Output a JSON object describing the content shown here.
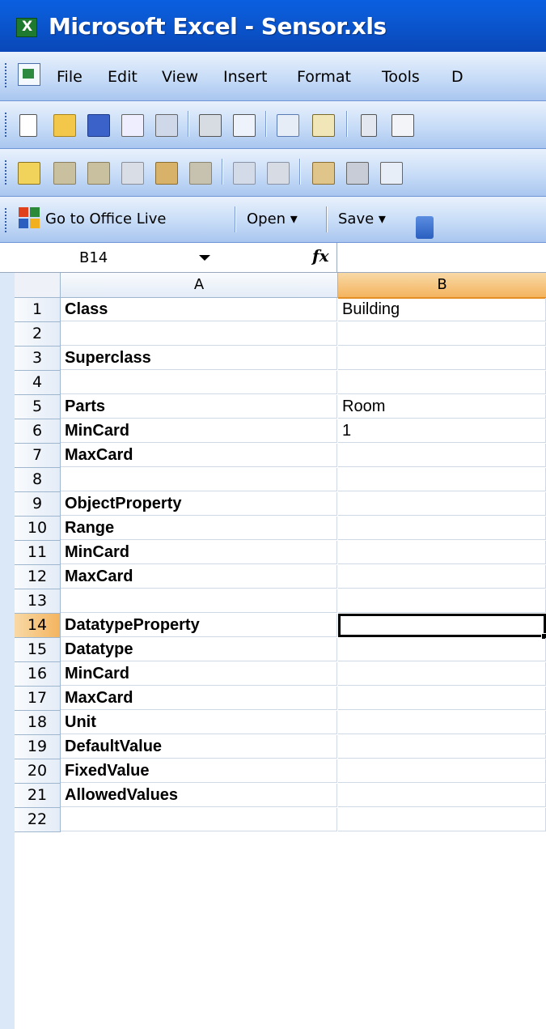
{
  "window": {
    "title": "Microsoft Excel - Sensor.xls"
  },
  "menu": {
    "items": [
      "File",
      "Edit",
      "View",
      "Insert",
      "Format",
      "Tools",
      "D"
    ]
  },
  "office_live_bar": {
    "go_to_label": "Go to Office Live",
    "open_label": "Open ▾",
    "save_label": "Save ▾"
  },
  "formula_bar": {
    "name_box": "B14",
    "fx_label": "fx",
    "value": ""
  },
  "sheet": {
    "columns": [
      "A",
      "B"
    ],
    "active_column": "B",
    "active_row": 14,
    "rows": [
      {
        "n": "1",
        "a": "Class",
        "b": "Building"
      },
      {
        "n": "2",
        "a": "",
        "b": ""
      },
      {
        "n": "3",
        "a": "Superclass",
        "b": ""
      },
      {
        "n": "4",
        "a": "",
        "b": ""
      },
      {
        "n": "5",
        "a": "Parts",
        "b": "Room"
      },
      {
        "n": "6",
        "a": "MinCard",
        "b": "1"
      },
      {
        "n": "7",
        "a": "MaxCard",
        "b": ""
      },
      {
        "n": "8",
        "a": "",
        "b": ""
      },
      {
        "n": "9",
        "a": "ObjectProperty",
        "b": ""
      },
      {
        "n": "10",
        "a": "Range",
        "b": ""
      },
      {
        "n": "11",
        "a": "MinCard",
        "b": ""
      },
      {
        "n": "12",
        "a": "MaxCard",
        "b": ""
      },
      {
        "n": "13",
        "a": "",
        "b": ""
      },
      {
        "n": "14",
        "a": "DatatypeProperty",
        "b": ""
      },
      {
        "n": "15",
        "a": "Datatype",
        "b": ""
      },
      {
        "n": "16",
        "a": "MinCard",
        "b": ""
      },
      {
        "n": "17",
        "a": "MaxCard",
        "b": ""
      },
      {
        "n": "18",
        "a": "Unit",
        "b": ""
      },
      {
        "n": "19",
        "a": "DefaultValue",
        "b": ""
      },
      {
        "n": "20",
        "a": "FixedValue",
        "b": ""
      },
      {
        "n": "21",
        "a": "AllowedValues",
        "b": ""
      },
      {
        "n": "22",
        "a": "",
        "b": ""
      }
    ]
  },
  "toolbar_standard": {
    "icons": [
      "new-icon",
      "open-icon",
      "save-icon",
      "permission-icon",
      "email-icon",
      "print-icon",
      "print-preview-icon",
      "spelling-icon",
      "research-icon",
      "cut-icon",
      "copy-icon"
    ]
  },
  "toolbar_reviewing": {
    "icons": [
      "new-comment-icon",
      "previous-comment-icon",
      "next-comment-icon",
      "show-comment-icon",
      "show-all-comments-icon",
      "delete-comment-icon",
      "track-changes-icon",
      "ink-icon",
      "reviewing-pane-icon",
      "protect-icon",
      "send-icon"
    ]
  },
  "colors": {
    "title_bar": "#0a5fe0",
    "active_header": "#f4b45f"
  }
}
